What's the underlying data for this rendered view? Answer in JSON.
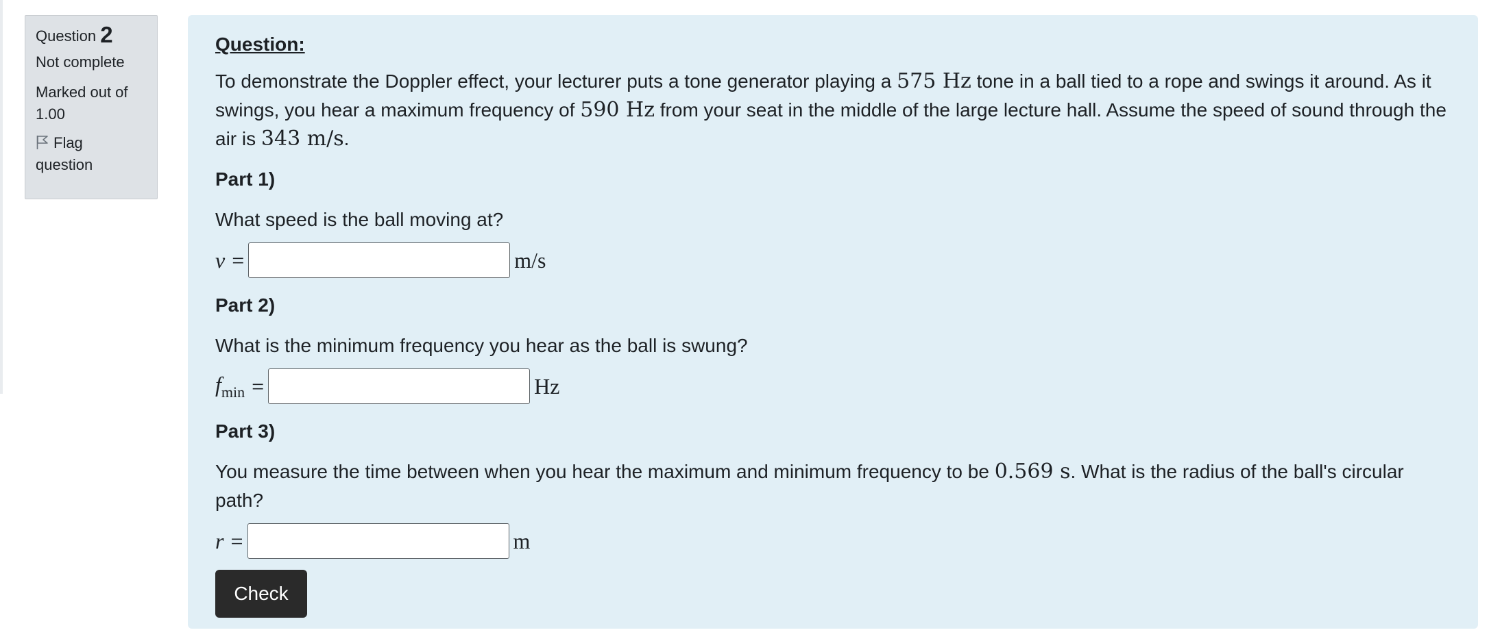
{
  "info": {
    "question_label": "Question",
    "question_number": "2",
    "state": "Not complete",
    "grade_line1": "Marked out of",
    "grade_line2": "1.00",
    "flag_line1": "Flag",
    "flag_line2": "question"
  },
  "content": {
    "heading": "Question:",
    "intro": {
      "t1": "To demonstrate the Doppler effect, your lecturer puts a tone generator playing a ",
      "m1": "575 Hz",
      "t2": " tone in a ball tied to a rope and swings it around. As it swings, you hear a maximum frequency of ",
      "m2": "590 Hz",
      "t3": " from your seat in the middle of the large lecture hall. Assume the speed of sound through the air is ",
      "m3": "343 m/s",
      "t4": "."
    },
    "parts": [
      {
        "heading": "Part 1)",
        "question": "What speed is the ball moving at?",
        "variable": "v",
        "variable_sub": "",
        "equals": "=",
        "unit": "m/s",
        "value": ""
      },
      {
        "heading": "Part 2)",
        "question": "What is the minimum frequency you hear as the ball is swung?",
        "variable": "f",
        "variable_sub": "min",
        "equals": "=",
        "unit": "Hz",
        "value": ""
      },
      {
        "heading": "Part 3)",
        "question_t1": "You measure the time between when you hear the maximum and minimum frequency to be ",
        "question_m1": "0.569 s",
        "question_t2": ". What is the radius of the ball's circular path?",
        "variable": "r",
        "variable_sub": "",
        "equals": "=",
        "unit": "m",
        "value": ""
      }
    ],
    "check_label": "Check"
  },
  "colors": {
    "info_background": "#dee2e6",
    "content_background": "#e1eff6",
    "button_background": "#2a2a2a",
    "text": "#1d2125"
  }
}
